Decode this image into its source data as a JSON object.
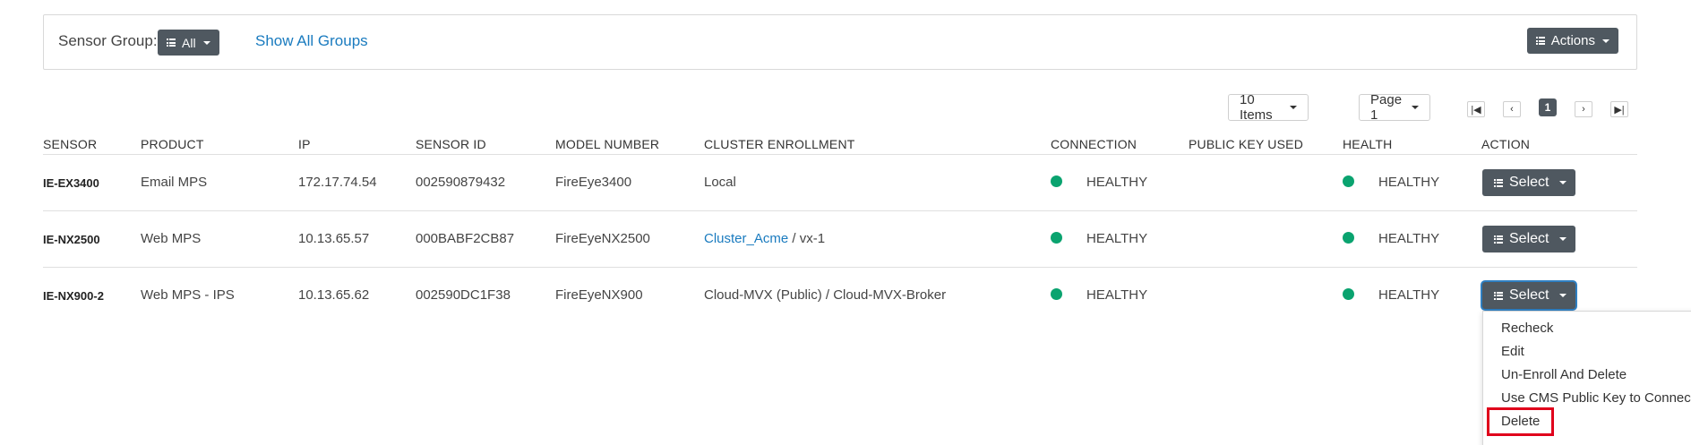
{
  "filter": {
    "sensor_group_label": "Sensor Group:",
    "group_value": "All",
    "show_all_link": "Show All Groups",
    "actions_label": "Actions"
  },
  "pagination": {
    "items_per_page": "10 Items",
    "page_select": "Page 1",
    "current_page": "1"
  },
  "table": {
    "columns": [
      "SENSOR",
      "PRODUCT",
      "IP",
      "SENSOR ID",
      "MODEL NUMBER",
      "CLUSTER ENROLLMENT",
      "CONNECTION",
      "PUBLIC KEY USED",
      "HEALTH",
      "ACTION"
    ],
    "rows": [
      {
        "sensor": "IE-EX3400",
        "product": "Email MPS",
        "ip": "172.17.74.54",
        "sensor_id": "002590879432",
        "model": "FireEye3400",
        "cluster_link": "",
        "cluster_text": "Local",
        "connection": "HEALTHY",
        "public_key": "",
        "health": "HEALTHY",
        "action": "Select"
      },
      {
        "sensor": "IE-NX2500",
        "product": "Web MPS",
        "ip": "10.13.65.57",
        "sensor_id": "000BABF2CB87",
        "model": "FireEyeNX2500",
        "cluster_link": "Cluster_Acme",
        "cluster_text": " / vx-1",
        "connection": "HEALTHY",
        "public_key": "",
        "health": "HEALTHY",
        "action": "Select"
      },
      {
        "sensor": "IE-NX900-2",
        "product": "Web MPS - IPS",
        "ip": "10.13.65.62",
        "sensor_id": "002590DC1F38",
        "model": "FireEyeNX900",
        "cluster_link": "",
        "cluster_text": "Cloud-MVX (Public) / Cloud-MVX-Broker",
        "connection": "HEALTHY",
        "public_key": "",
        "health": "HEALTHY",
        "action": "Select"
      }
    ]
  },
  "dropdown": {
    "items": [
      "Recheck",
      "Edit",
      "Un-Enroll And Delete",
      "Use CMS Public Key to Connect",
      "Delete"
    ],
    "highlighted": "Delete"
  },
  "colors": {
    "status_healthy": "#0aa36f",
    "button_dark": "#4f5860",
    "link": "#1a7bbf",
    "highlight": "#e0001b"
  }
}
